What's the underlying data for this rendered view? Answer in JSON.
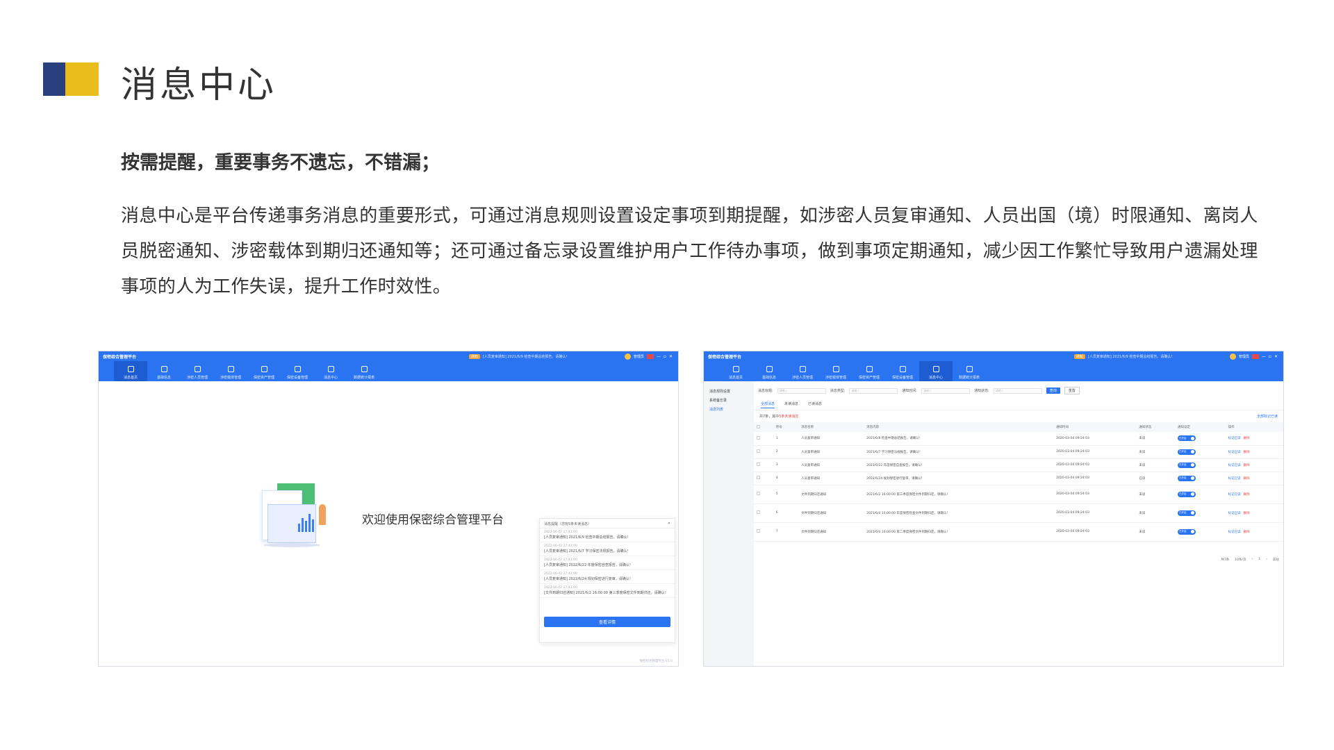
{
  "colors": {
    "logo_dark": "#2a3f7e",
    "logo_gold": "#e9be1c",
    "brand_blue": "#2a74f2"
  },
  "page": {
    "title": "消息中心",
    "subtitle": "按需提醒，重要事务不遗忘，不错漏；",
    "description": "消息中心是平台传递事务消息的重要形式，可通过消息规则设置设定事项到期提醒，如涉密人员复审通知、人员出国（境）时限通知、离岗人员脱密通知、涉密载体到期归还通知等；还可通过备忘录设置维护用户工作待办事项，做到事项定期通知，减少因工作繁忙导致用户遗漏处理事项的人为工作失误，提升工作时效性。"
  },
  "app": {
    "brand": "保密综合管理平台",
    "nav": [
      "消息首页",
      "基础信息",
      "涉密人员管理",
      "涉密载体管理",
      "保密资产管理",
      "保密设备管理",
      "消息中心",
      "数据统计报表"
    ],
    "notice_badge": "通知",
    "user": "管理员"
  },
  "left_shot": {
    "welcome": "欢迎使用保密综合管理平台",
    "panel_title": "消息提醒（您有5条未读消息）",
    "messages": [
      {
        "time": "2022-06-02 17:43:00",
        "text": "[人员复审通知] 2021/6/9 检查中期总结报告，请确认！"
      },
      {
        "time": "2022-06-02 17:43:00",
        "text": "[人员复审通知] 2021/6/7 学习保密法规报告，请确认！"
      },
      {
        "time": "2022-06-02 17:43:00",
        "text": "[人员复审通知] 2022/6/22 年度保密自查报告，请确认！"
      },
      {
        "time": "2022-06-02 17:43:00",
        "text": "[人员复审通知] 2022/6/24 规划保密进行复审，请确认！"
      },
      {
        "time": "2022-06-02 17:43:00",
        "text": "[文件到期归还通知] 2021/6/2 16:00:00 第三季度保密文件到期归还，请确认！"
      }
    ],
    "button": "查看详情",
    "footer": "保密综合管理平台 V1.0"
  },
  "right_shot": {
    "side": [
      "消息规则设置",
      "系统备忘录",
      "消息列表"
    ],
    "filters": {
      "title_label": "消息标题:",
      "type_label": "消息类型:",
      "time_label": "通知时间:",
      "status_label": "通知状态:",
      "placeholder": "请输入",
      "query": "查询",
      "reset": "重置"
    },
    "tabs": [
      "全部消息",
      "未读消息",
      "已读消息"
    ],
    "stat_prefix": "共7条，其中",
    "stat_red": "5条未读消息",
    "mark_all": "全部标记已读",
    "columns": [
      "",
      "序号",
      "消息名称",
      "消息内容",
      "通知时间",
      "通知状态",
      "通知设定",
      "操作"
    ],
    "rows": [
      {
        "no": "1",
        "name": "人员复审通知",
        "content": "2021/6/8 检查中期总结报告，请确认！",
        "time": "2020-03-04 09:24:03",
        "status": "未读",
        "switch": "已开启"
      },
      {
        "no": "2",
        "name": "人员复审通知",
        "content": "2021/6/7 学习保密法规报告，请确认！",
        "time": "2020-03-04 09:24:03",
        "status": "未读",
        "switch": "已开启"
      },
      {
        "no": "3",
        "name": "人员复审通知",
        "content": "2021/6/22 年度保密自查报告，请确认！",
        "time": "2020-03-04 09:24:03",
        "status": "未读",
        "switch": "已开启"
      },
      {
        "no": "4",
        "name": "人员复审通知",
        "content": "2022/6/24 规划保密进行复审，请确认！",
        "time": "2020-03-04 09:24:03",
        "status": "已读",
        "switch": "已开启"
      },
      {
        "no": "5",
        "name": "文件到期归还通知",
        "content": "2021/6/2 16:00:00 第三季度保密文件到期归还，请确认！",
        "time": "2020-03-04 09:24:03",
        "status": "未读",
        "switch": "已开启"
      },
      {
        "no": "6",
        "name": "文件到期归还通知",
        "content": "2021/6/4 10:00:00 年度保密检查文件到期归还，请确认！",
        "time": "2020-03-04 09:24:03",
        "status": "未读",
        "switch": "已开启"
      },
      {
        "no": "7",
        "name": "文件到期归还通知",
        "content": "2021/6/4 10:00:00 第二季度保密文件到期归还，请确认！",
        "time": "2020-03-04 09:24:03",
        "status": "未读",
        "switch": "已开启"
      }
    ],
    "op_mark": "标记已读",
    "op_delete": "删除",
    "pager": {
      "total": "共7条",
      "size": "10条/页",
      "page": "1",
      "goto": "前往"
    }
  }
}
